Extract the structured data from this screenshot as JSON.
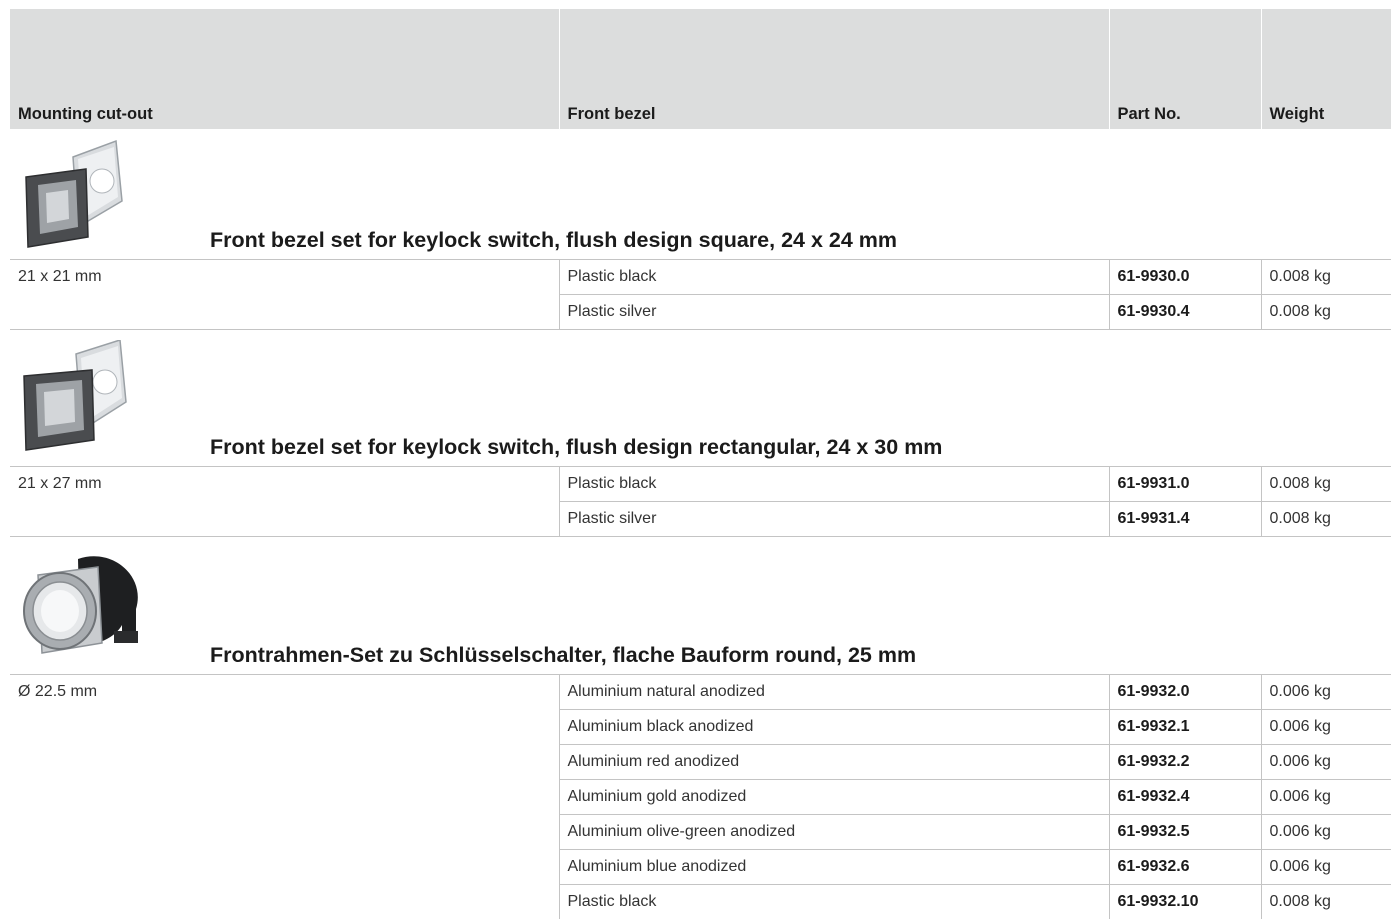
{
  "columns": {
    "mounting": "Mounting cut-out",
    "bezel": "Front bezel",
    "part_no": "Part No.",
    "weight": "Weight"
  },
  "groups": [
    {
      "title": "Front bezel set for keylock switch, flush design square, 24 x 24 mm",
      "image_icon": "square-bezel-icon",
      "cutout": "21 x 21 mm",
      "rows": [
        {
          "bezel": "Plastic black",
          "part_no": "61-9930.0",
          "weight": "0.008 kg"
        },
        {
          "bezel": "Plastic silver",
          "part_no": "61-9930.4",
          "weight": "0.008 kg"
        }
      ]
    },
    {
      "title": "Front bezel set for keylock switch, flush design rectangular, 24 x 30 mm",
      "image_icon": "rectangular-bezel-icon",
      "cutout": "21 x 27 mm",
      "rows": [
        {
          "bezel": "Plastic black",
          "part_no": "61-9931.0",
          "weight": "0.008 kg"
        },
        {
          "bezel": "Plastic silver",
          "part_no": "61-9931.4",
          "weight": "0.008 kg"
        }
      ]
    },
    {
      "title": "Frontrahmen-Set zu Schlüsselschalter, flache Bauform round, 25 mm",
      "image_icon": "round-bezel-icon",
      "cutout": "Ø 22.5 mm",
      "rows": [
        {
          "bezel": "Aluminium natural anodized",
          "part_no": "61-9932.0",
          "weight": "0.006 kg"
        },
        {
          "bezel": "Aluminium black anodized",
          "part_no": "61-9932.1",
          "weight": "0.006 kg"
        },
        {
          "bezel": "Aluminium red anodized",
          "part_no": "61-9932.2",
          "weight": "0.006 kg"
        },
        {
          "bezel": "Aluminium gold anodized",
          "part_no": "61-9932.4",
          "weight": "0.006 kg"
        },
        {
          "bezel": "Aluminium olive-green anodized",
          "part_no": "61-9932.5",
          "weight": "0.006 kg"
        },
        {
          "bezel": "Aluminium blue anodized",
          "part_no": "61-9932.6",
          "weight": "0.006 kg"
        },
        {
          "bezel": "Plastic black",
          "part_no": "61-9932.10",
          "weight": "0.008 kg"
        }
      ]
    }
  ]
}
